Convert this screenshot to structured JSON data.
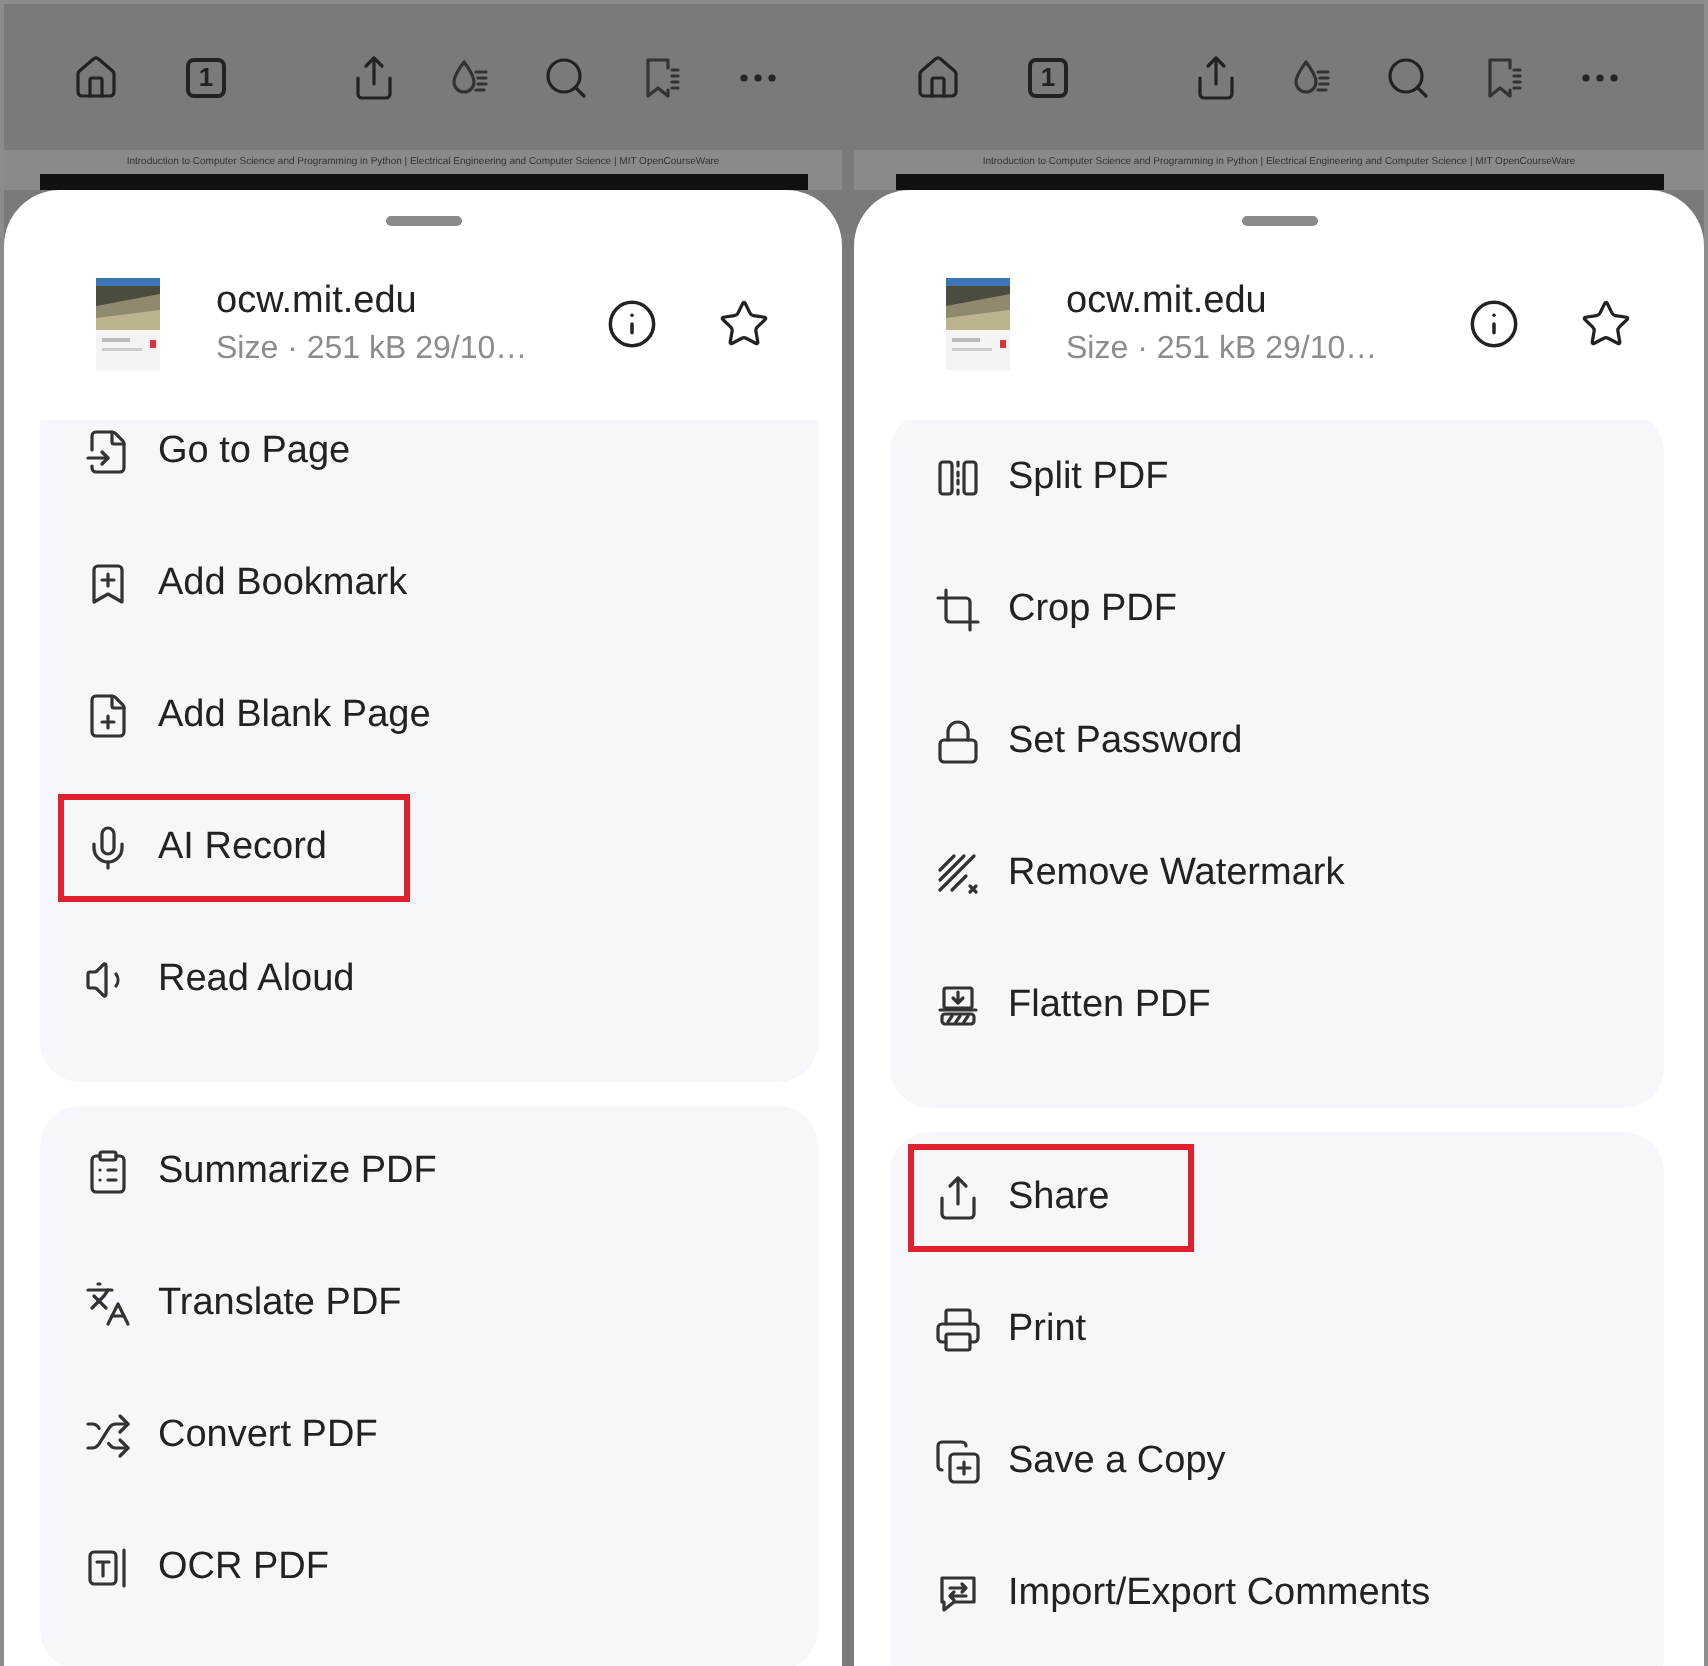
{
  "panels": [
    {
      "toolbar": {
        "page_number": "1"
      },
      "document": {
        "header_text": "Introduction to Computer Science and Programming in Python | Electrical Engineering and Computer Science | MIT OpenCourseWare"
      },
      "sheet": {
        "file_name": "ocw.mit.edu",
        "file_info": "Size · 251 kB 29/10…"
      },
      "groups": [
        {
          "items": [
            {
              "label": "Go to Page",
              "highlighted": false
            },
            {
              "label": "Add Bookmark",
              "highlighted": false
            },
            {
              "label": "Add Blank Page",
              "highlighted": false
            },
            {
              "label": "AI Record",
              "highlighted": true
            },
            {
              "label": "Read Aloud",
              "highlighted": false
            }
          ]
        },
        {
          "items": [
            {
              "label": "Summarize PDF",
              "highlighted": false
            },
            {
              "label": "Translate PDF",
              "highlighted": false
            },
            {
              "label": "Convert PDF",
              "highlighted": false
            },
            {
              "label": "OCR PDF",
              "highlighted": false
            }
          ]
        }
      ]
    },
    {
      "toolbar": {
        "page_number": "1"
      },
      "document": {
        "header_text": "Introduction to Computer Science and Programming in Python | Electrical Engineering and Computer Science | MIT OpenCourseWare"
      },
      "sheet": {
        "file_name": "ocw.mit.edu",
        "file_info": "Size · 251 kB 29/10…"
      },
      "groups": [
        {
          "items": [
            {
              "label": "Split PDF",
              "highlighted": false
            },
            {
              "label": "Crop PDF",
              "highlighted": false
            },
            {
              "label": "Set Password",
              "highlighted": false
            },
            {
              "label": "Remove Watermark",
              "highlighted": false
            },
            {
              "label": "Flatten PDF",
              "highlighted": false
            }
          ]
        },
        {
          "items": [
            {
              "label": "Share",
              "highlighted": true
            },
            {
              "label": "Print",
              "highlighted": false
            },
            {
              "label": "Save a Copy",
              "highlighted": false
            },
            {
              "label": "Import/Export Comments",
              "highlighted": false
            }
          ]
        }
      ]
    }
  ]
}
